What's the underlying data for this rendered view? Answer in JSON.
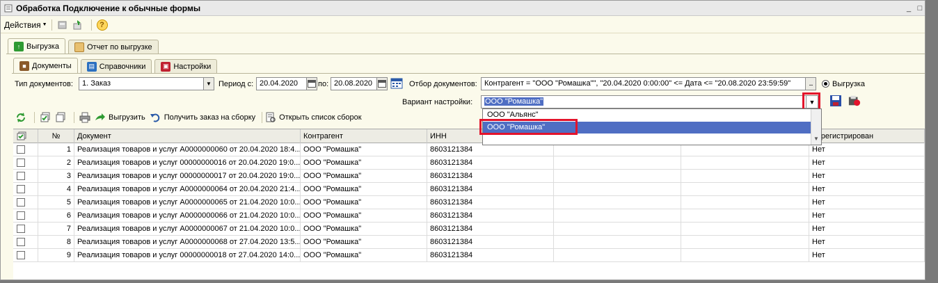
{
  "window": {
    "title": "Обработка  Подключение к обычные формы"
  },
  "menubar": {
    "actions_label": "Действия"
  },
  "main_tabs": [
    {
      "label": "Выгрузка",
      "icon": "upload-icon",
      "color": "#2e9a32"
    },
    {
      "label": "Отчет по выгрузке",
      "icon": "report-icon",
      "color": "#d8a040"
    }
  ],
  "sub_tabs": [
    {
      "label": "Документы",
      "icon": "briefcase-icon",
      "color": "#8a5a2a"
    },
    {
      "label": "Справочники",
      "icon": "catalog-icon",
      "color": "#2a6fc0"
    },
    {
      "label": "Настройки",
      "icon": "settings-icon",
      "color": "#c02030"
    }
  ],
  "filters": {
    "doc_type_label": "Тип документов:",
    "doc_type_value": "1. Заказ",
    "period_from_label": "Период с:",
    "period_from_value": "20.04.2020",
    "period_to_label": "по:",
    "period_to_value": "20.08.2020",
    "selection_label": "Отбор документов:",
    "selection_value": "Контрагент = \"ООО \"Ромашка\"\", \"20.04.2020 0:00:00\" <= Дата <= \"20.08.2020 23:59:59\"",
    "selection_btn": "...",
    "radio_label": "Выгрузка",
    "variant_label": "Вариант настройки:",
    "variant_value": "ООО \"Ромашка\""
  },
  "dropdown": {
    "options": [
      "ООО \"Альянс\"",
      "ООО \"Ромашка\""
    ],
    "selected_index": 1
  },
  "toolbar": {
    "upload_label": "Выгрузить",
    "get_order_label": "Получить заказ на сборку",
    "open_list_label": "Открыть список сборок"
  },
  "table": {
    "headers": [
      "№",
      "Документ",
      "Контрагент",
      "ИНН",
      "",
      "",
      "Зарегистрирован"
    ],
    "rows": [
      {
        "num": "1",
        "doc": "Реализация товаров и услуг А0000000060 от 20.04.2020 18:4...",
        "counterparty": "ООО \"Ромашка\"",
        "inn": "8603121384",
        "registered": "Нет"
      },
      {
        "num": "2",
        "doc": "Реализация товаров и услуг 00000000016 от 20.04.2020 19:0...",
        "counterparty": "ООО \"Ромашка\"",
        "inn": "8603121384",
        "registered": "Нет"
      },
      {
        "num": "3",
        "doc": "Реализация товаров и услуг 00000000017 от 20.04.2020 19:0...",
        "counterparty": "ООО \"Ромашка\"",
        "inn": "8603121384",
        "registered": "Нет"
      },
      {
        "num": "4",
        "doc": "Реализация товаров и услуг А0000000064 от 20.04.2020 21:4...",
        "counterparty": "ООО \"Ромашка\"",
        "inn": "8603121384",
        "registered": "Нет"
      },
      {
        "num": "5",
        "doc": "Реализация товаров и услуг А0000000065 от 21.04.2020 10:0...",
        "counterparty": "ООО \"Ромашка\"",
        "inn": "8603121384",
        "registered": "Нет"
      },
      {
        "num": "6",
        "doc": "Реализация товаров и услуг А0000000066 от 21.04.2020 10:0...",
        "counterparty": "ООО \"Ромашка\"",
        "inn": "8603121384",
        "registered": "Нет"
      },
      {
        "num": "7",
        "doc": "Реализация товаров и услуг А0000000067 от 21.04.2020 10:0...",
        "counterparty": "ООО \"Ромашка\"",
        "inn": "8603121384",
        "registered": "Нет"
      },
      {
        "num": "8",
        "doc": "Реализация товаров и услуг А0000000068 от 27.04.2020 13:5...",
        "counterparty": "ООО \"Ромашка\"",
        "inn": "8603121384",
        "registered": "Нет"
      },
      {
        "num": "9",
        "doc": "Реализация товаров и услуг 00000000018 от 27.04.2020 14:0...",
        "counterparty": "ООО \"Ромашка\"",
        "inn": "8603121384",
        "registered": "Нет"
      }
    ]
  },
  "colors": {
    "highlight_border": "#e3132b",
    "dropdown_selected": "#4f6ec3",
    "form_background": "#fbfaeb"
  }
}
